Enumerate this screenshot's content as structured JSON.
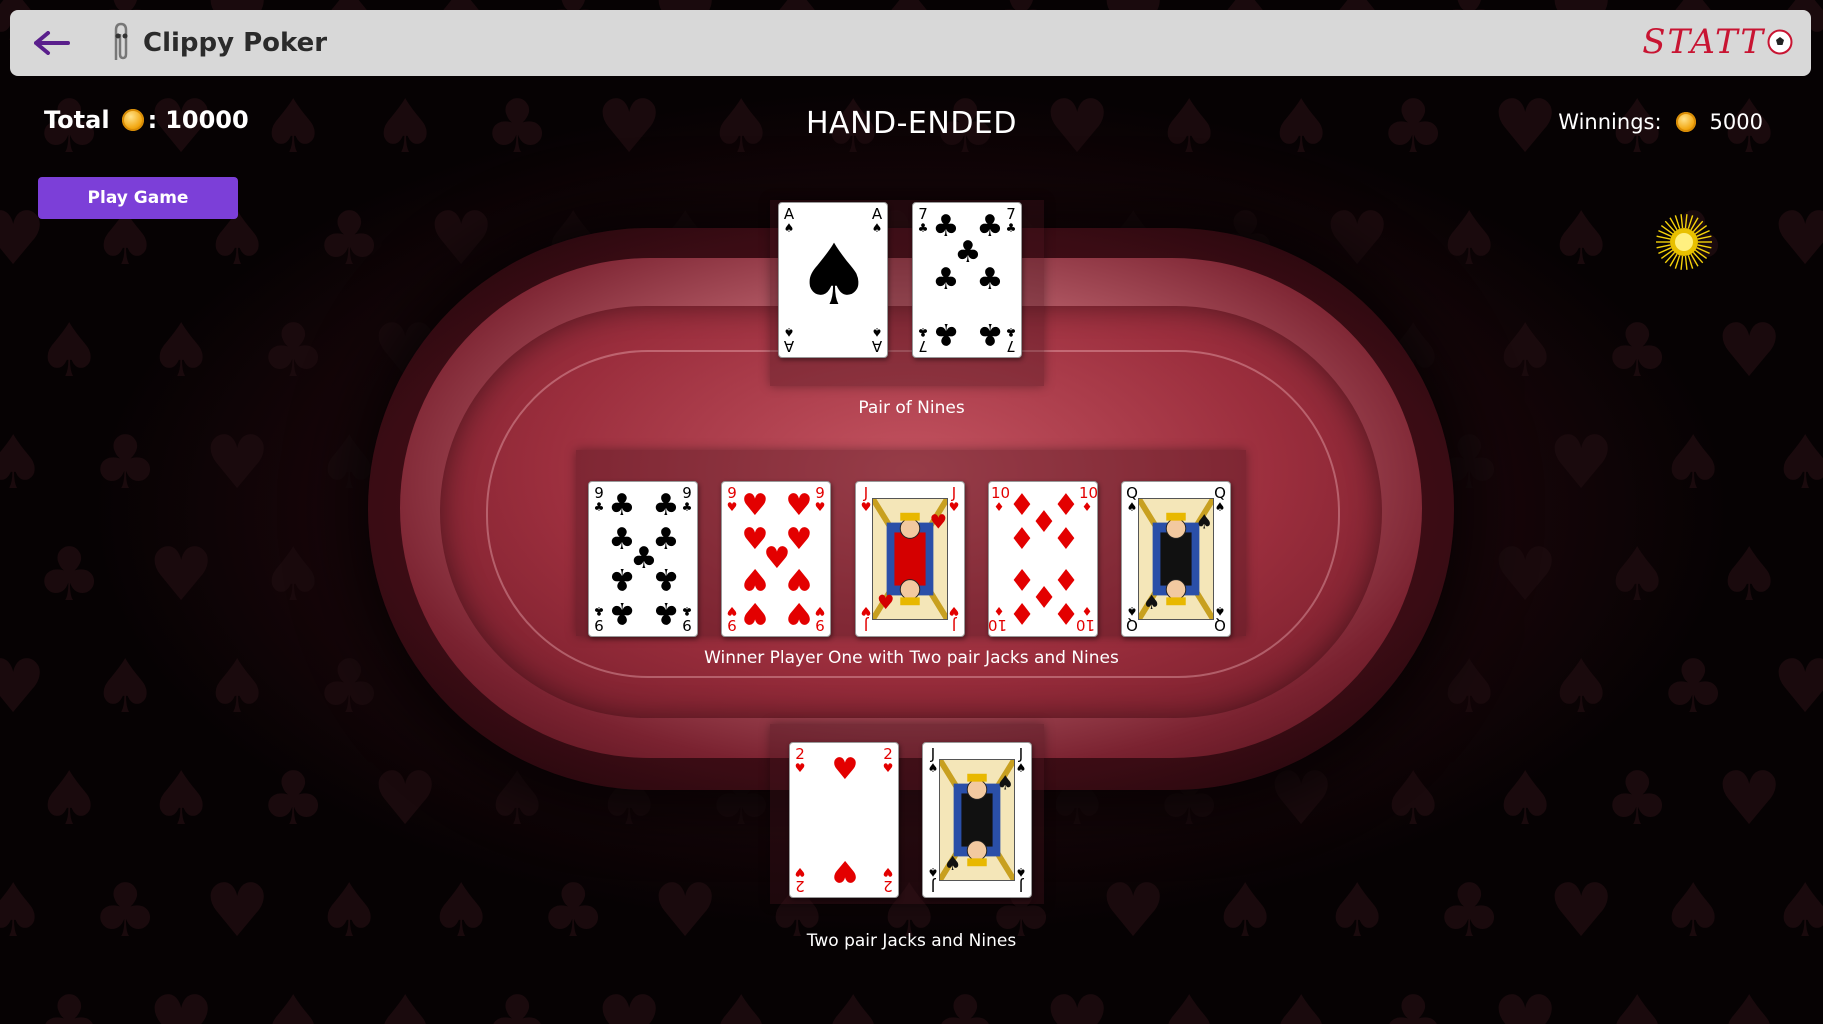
{
  "header": {
    "back_icon": "back-arrow-icon",
    "app_icon": "paperclip-icon",
    "title": "Clippy Poker",
    "brand_logo_text": "STATT",
    "brand_ball_icon": "soccer-ball-icon"
  },
  "hud": {
    "total_label": "Total",
    "total_separator": ":",
    "total_value": "10000",
    "status": "HAND-ENDED",
    "winnings_label": "Winnings:",
    "winnings_value": "5000",
    "coin_icon": "coin-icon"
  },
  "controls": {
    "play_button": "Play Game"
  },
  "dealer_hand": {
    "cards": [
      {
        "rank": "A",
        "suit": "spades"
      },
      {
        "rank": "7",
        "suit": "clubs"
      }
    ],
    "result": "Pair of Nines"
  },
  "board": {
    "cards": [
      {
        "rank": "9",
        "suit": "clubs"
      },
      {
        "rank": "9",
        "suit": "hearts"
      },
      {
        "rank": "J",
        "suit": "hearts"
      },
      {
        "rank": "10",
        "suit": "diamonds"
      },
      {
        "rank": "Q",
        "suit": "spades"
      }
    ],
    "result": "Winner Player One with Two pair Jacks and Nines"
  },
  "player_hand": {
    "cards": [
      {
        "rank": "2",
        "suit": "hearts"
      },
      {
        "rank": "J",
        "suit": "spades"
      }
    ],
    "result": "Two pair Jacks and Nines"
  },
  "colors": {
    "accent": "#7c3fd8",
    "felt": "#9b2e3d",
    "red_suit": "#e30000",
    "topbar": "#d8d8d8",
    "brand": "#c81432"
  }
}
